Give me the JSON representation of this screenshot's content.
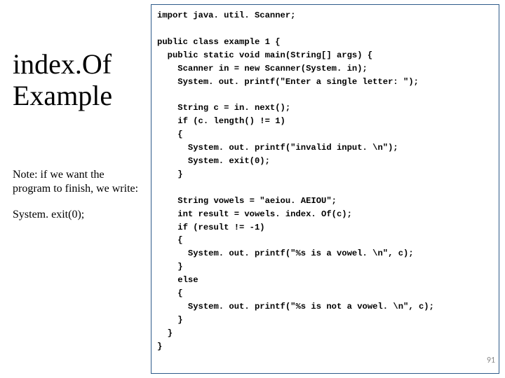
{
  "left": {
    "title_line1": "index.Of",
    "title_line2": "Example",
    "note_text": "Note: if we want  the program to finish, we write:",
    "note_code": "System. exit(0);"
  },
  "code": {
    "l01": "import java. util. Scanner;",
    "l02": "",
    "l03": "public class example 1 {",
    "l04": "  public static void main(String[] args) {",
    "l05": "    Scanner in = new Scanner(System. in);",
    "l06": "    System. out. printf(\"Enter a single letter: \");",
    "l07": "",
    "l08": "    String c = in. next();",
    "l09": "    if (c. length() != 1)",
    "l10": "    {",
    "l11": "      System. out. printf(\"invalid input. \\n\");",
    "l12": "      System. exit(0);",
    "l13": "    }",
    "l14": "",
    "l15": "    String vowels = \"aeiou. AEIOU\";",
    "l16": "    int result = vowels. index. Of(c);",
    "l17": "    if (result != -1)",
    "l18": "    {",
    "l19": "      System. out. printf(\"%s is a vowel. \\n\", c);",
    "l20": "    }",
    "l21": "    else",
    "l22": "    {",
    "l23": "      System. out. printf(\"%s is not a vowel. \\n\", c);",
    "l24": "    }",
    "l25": "  }",
    "l26": "}"
  },
  "page_number": "91"
}
